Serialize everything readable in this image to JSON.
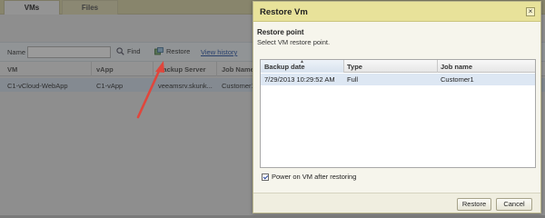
{
  "tabs": [
    {
      "label": "VMs",
      "active": true
    },
    {
      "label": "Files",
      "active": false
    }
  ],
  "toolbar": {
    "name_label": "Name",
    "name_value": "",
    "find_label": "Find",
    "restore_label": "Restore",
    "view_history_label": "View history"
  },
  "grid": {
    "columns": [
      "VM",
      "vApp",
      "Backup Server",
      "Job Name"
    ],
    "rows": [
      {
        "vm": "C1-vCloud-WebApp",
        "vapp": "C1-vApp",
        "backup_server": "veeamsrv.skunk...",
        "job_name": "Customer1"
      }
    ]
  },
  "dialog": {
    "title": "Restore Vm",
    "close_glyph": "×",
    "restore_point_title": "Restore point",
    "restore_point_subtitle": "Select VM restore point.",
    "columns": [
      "Backup date",
      "Type",
      "Job name"
    ],
    "rows": [
      {
        "backup_date": "7/29/2013 10:29:52 AM",
        "type": "Full",
        "job_name": "Customer1"
      }
    ],
    "power_on_label": "Power on VM after restoring",
    "power_on_checked": true,
    "restore_button": "Restore",
    "cancel_button": "Cancel"
  },
  "colors": {
    "dialog_titlebar": "#e8e29a",
    "selected_row": "#dde7f3",
    "annotation_arrow": "#e0463c",
    "link": "#2a55a8"
  }
}
